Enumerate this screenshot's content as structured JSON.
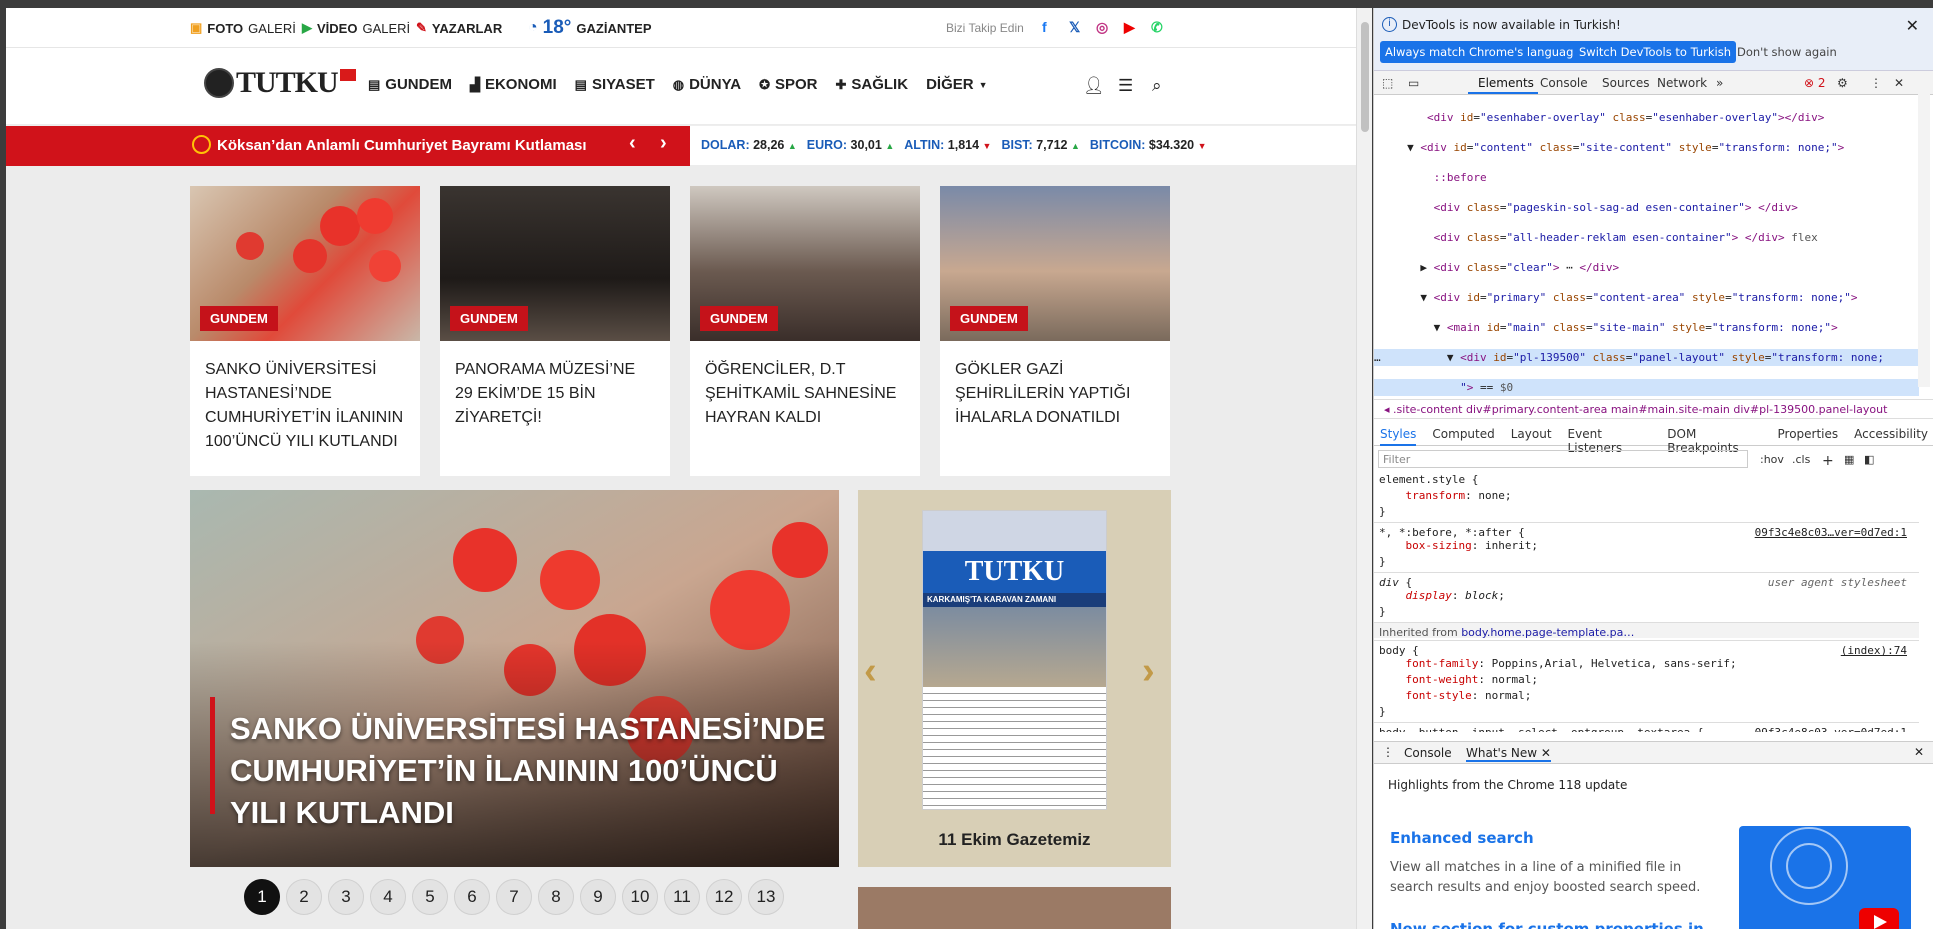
{
  "topbar": {
    "items": [
      {
        "icon": "image-icon",
        "bold": "FOTO",
        "light": "GALERİ"
      },
      {
        "icon": "play-icon",
        "bold": "VİDEO",
        "light": "GALERİ"
      },
      {
        "icon": "pen-icon",
        "bold": "YAZARLAR",
        "light": ""
      }
    ],
    "weather_temp": "18°",
    "weather_city": "GAZİANTEP",
    "follow_label": "Bizi Takip Edin",
    "social": [
      "f",
      "𝕏",
      "◎",
      "▶",
      "✆"
    ]
  },
  "header": {
    "logo_text": "TUTKU",
    "nav": [
      {
        "label": "GUNDEM",
        "icon": "newspaper-icon"
      },
      {
        "label": "EKONOMI",
        "icon": "chart-icon"
      },
      {
        "label": "SIYASET",
        "icon": "newspaper2-icon"
      },
      {
        "label": "DÜNYA",
        "icon": "globe-icon"
      },
      {
        "label": "SPOR",
        "icon": "ball-icon"
      },
      {
        "label": "SAĞLIK",
        "icon": "medkit-icon"
      },
      {
        "label": "DİĞER",
        "icon": ""
      }
    ]
  },
  "ticker": {
    "headline": "Köksan’dan Anlamlı Cumhuriyet Bayramı Kutlaması",
    "markets": [
      {
        "label": "DOLAR:",
        "value": "28,26",
        "dir": "up"
      },
      {
        "label": "EURO:",
        "value": "30,01",
        "dir": "up"
      },
      {
        "label": "ALTIN:",
        "value": "1,814",
        "dir": "down"
      },
      {
        "label": "BIST:",
        "value": "7,712",
        "dir": "up"
      },
      {
        "label": "BITCOIN:",
        "value": "$34.320",
        "dir": "down"
      }
    ]
  },
  "cards": [
    {
      "tag": "GUNDEM",
      "title": "SANKO ÜNİVERSİTESİ HASTANESİ’NDE CUMHURİYET’İN İLANININ 100’ÜNCÜ YILI KUTLANDI"
    },
    {
      "tag": "GUNDEM",
      "title": "PANORAMA MÜZESİ’NE 29 EKİM’DE 15 BİN ZİYARETÇİ!"
    },
    {
      "tag": "GUNDEM",
      "title": "ÖĞRENCİLER, D.T ŞEHİTKAMİL SAHNESİNE HAYRAN KALDI"
    },
    {
      "tag": "GUNDEM",
      "title": "GÖKLER GAZİ ŞEHİRLİLERİN YAPTIĞI İHALARLA DONATILDI"
    }
  ],
  "hero": {
    "title": "SANKO ÜNİVERSİTESİ HASTANESİ’NDE CUMHURİYET’İN İLANININ 100’ÜNCÜ YILI KUTLANDI"
  },
  "newspaper": {
    "title": "11 Ekim Gazetemiz",
    "masthead": "TUTKU",
    "headline": "KARKAMIŞ'TA KARAVAN ZAMANI"
  },
  "pager": {
    "pages": [
      "1",
      "2",
      "3",
      "4",
      "5",
      "6",
      "7",
      "8",
      "9",
      "10",
      "11",
      "12",
      "13"
    ],
    "active": "1"
  },
  "devtools": {
    "info_message": "DevTools is now available in Turkish!",
    "btn_match": "Always match Chrome's language",
    "btn_switch": "Switch DevTools to Turkish",
    "btn_dont": "Don't show again",
    "tabs": [
      "Elements",
      "Console",
      "Sources",
      "Network"
    ],
    "error_count": "2",
    "breadcrumbs": [
      ".site-content",
      "div#primary.content-area",
      "main#main.site-main",
      "div#pl-139500.panel-layout"
    ],
    "style_tabs": [
      "Styles",
      "Computed",
      "Layout",
      "Event Listeners",
      "DOM Breakpoints",
      "Properties",
      "Accessibility"
    ],
    "filter_placeholder": "Filter",
    "filter_btns": [
      ":hov",
      ".cls"
    ],
    "drawer_tabs": [
      "Console",
      "What's New"
    ],
    "highlights": "Highlights from the Chrome 118 update",
    "feature_title": "Enhanced search",
    "feature_text": "View all matches in a line of a minified file in search results and enjoy boosted search speed.",
    "next_feature": "New section for custom properties in"
  }
}
